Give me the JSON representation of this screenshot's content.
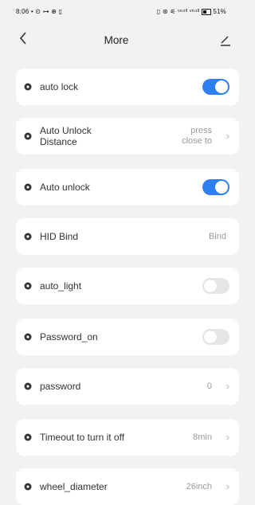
{
  "status_bar": {
    "time": "8:06",
    "left_icons": "• ⊙ ⊶ ⊕ ▯",
    "right_icons": "▯ ⊛ ⚟ ᵛᵒ⁴ˡˡ ᵛᵒ⁴ˡˡ",
    "battery": "51%"
  },
  "header": {
    "back_icon": "chevron-left",
    "title": "More",
    "edit_icon": "pencil"
  },
  "accent_color": "#2f7ff2",
  "settings": [
    {
      "label": "auto lock",
      "control": "toggle",
      "state": "on"
    },
    {
      "label_line1": "Auto Unlock",
      "label_line2": "Distance",
      "value_line1": "press",
      "value_line2": "close to",
      "control": "chevron"
    },
    {
      "label": "Auto unlock",
      "control": "toggle",
      "state": "on"
    },
    {
      "label": "HID Bind",
      "value": "Bind",
      "control": "value"
    },
    {
      "label": "auto_light",
      "control": "toggle",
      "state": "off"
    },
    {
      "label": "Password_on",
      "control": "toggle",
      "state": "off"
    },
    {
      "label": "password",
      "value": "0",
      "control": "chevron"
    },
    {
      "label": "Timeout to turn it off",
      "value": "8min",
      "control": "chevron"
    },
    {
      "label": "wheel_diameter",
      "value": "26inch",
      "control": "chevron"
    }
  ]
}
